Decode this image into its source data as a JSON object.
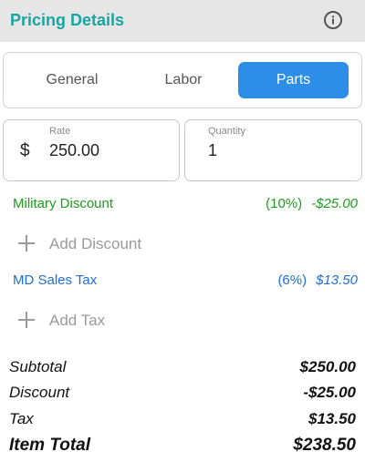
{
  "header": {
    "title": "Pricing Details",
    "info_icon": "info-icon",
    "title_color": "#19a5a1"
  },
  "tabs": [
    {
      "label": "General",
      "selected": false
    },
    {
      "label": "Labor",
      "selected": false
    },
    {
      "label": "Parts",
      "selected": true
    }
  ],
  "accent_color": "#2c8ee6",
  "fields": {
    "rate": {
      "label": "Rate",
      "currency_symbol": "$",
      "value": "250.00"
    },
    "quantity": {
      "label": "Quantity",
      "value": "1"
    }
  },
  "discount": {
    "name": "Military Discount",
    "percent": "(10%)",
    "amount": "-$25.00",
    "color": "#1e9c1e"
  },
  "add_discount": {
    "label": "Add Discount",
    "icon": "plus-icon"
  },
  "tax": {
    "name": "MD Sales Tax",
    "percent": "(6%)",
    "amount": "$13.50",
    "color": "#1f6fd1"
  },
  "add_tax": {
    "label": "Add Tax",
    "icon": "plus-icon"
  },
  "totals": {
    "subtotal_label": "Subtotal",
    "subtotal_value": "$250.00",
    "discount_label": "Discount",
    "discount_value": "-$25.00",
    "tax_label": "Tax",
    "tax_value": "$13.50",
    "item_total_label": "Item Total",
    "item_total_value": "$238.50"
  }
}
